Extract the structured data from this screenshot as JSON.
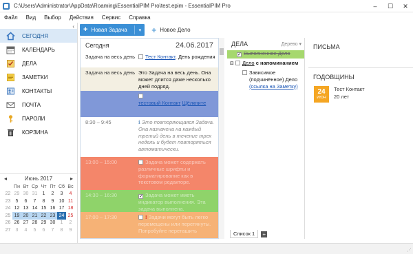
{
  "window": {
    "title": "C:\\Users\\Administrator\\AppData\\Roaming\\EssentialPIM Pro\\test.epim - EssentialPIM Pro",
    "minimize": "–",
    "maximize": "☐",
    "close": "✕"
  },
  "menu": [
    "Файл",
    "Вид",
    "Выбор",
    "Действия",
    "Сервис",
    "Справка"
  ],
  "toolbar": {
    "new_task": "Новая Задача",
    "new_item": "Новое Дело"
  },
  "sidebar": {
    "collapse": "‹",
    "items": [
      {
        "label": "СЕГОДНЯ",
        "icon": "house-icon",
        "color": "#3a78c2"
      },
      {
        "label": "КАЛЕНДАРЬ",
        "icon": "calendar-icon",
        "color": "#6d6d6d"
      },
      {
        "label": "ДЕЛА",
        "icon": "tasks-icon",
        "color": "#d8a32a"
      },
      {
        "label": "ЗАМЕТКИ",
        "icon": "notes-icon",
        "color": "#f0c232"
      },
      {
        "label": "КОНТАКТЫ",
        "icon": "contacts-icon",
        "color": "#4a7fc0"
      },
      {
        "label": "ПОЧТА",
        "icon": "mail-icon",
        "color": "#6a6a6a"
      },
      {
        "label": "ПАРОЛИ",
        "icon": "key-icon",
        "color": "#e0a020"
      },
      {
        "label": "КОРЗИНА",
        "icon": "trash-icon",
        "color": "#3a3a3a"
      }
    ]
  },
  "calendar": {
    "prev": "◂",
    "next": "▸",
    "month_title": "Июнь 2017",
    "weekdays": [
      "Пн",
      "Вт",
      "Ср",
      "Чт",
      "Пт",
      "Сб",
      "Вс"
    ],
    "weeks": [
      {
        "wk": "22",
        "days": [
          "29",
          "30",
          "31",
          "1",
          "2",
          "3",
          "4"
        ]
      },
      {
        "wk": "23",
        "days": [
          "5",
          "6",
          "7",
          "8",
          "9",
          "10",
          "11"
        ]
      },
      {
        "wk": "24",
        "days": [
          "12",
          "13",
          "14",
          "15",
          "16",
          "17",
          "18"
        ]
      },
      {
        "wk": "25",
        "days": [
          "19",
          "20",
          "21",
          "22",
          "23",
          "24",
          "25"
        ]
      },
      {
        "wk": "26",
        "days": [
          "26",
          "27",
          "28",
          "29",
          "30",
          "1",
          "2"
        ]
      },
      {
        "wk": "27",
        "days": [
          "3",
          "4",
          "5",
          "6",
          "7",
          "8",
          "9"
        ]
      }
    ]
  },
  "today_panel": {
    "title": "Сегодня",
    "date": "24.06.2017",
    "rows": [
      {
        "time": "Задача на весь день",
        "text_link": "Тест Контакт",
        "text": ". День рождения",
        "bg": "#ffffff"
      },
      {
        "time": "Задача на весь день",
        "text": "Это Задача на весь день. Она может длится даже несколько дней подряд.",
        "bg": "#f3efe2"
      },
      {
        "time": "",
        "text_link": "тестовый Контакт",
        "text2": "Щёлкните",
        "bg": "#8098d8"
      },
      {
        "time": "8:30 – 9:45",
        "text": "Это повторяющаяся Задача. Она назначена на каждый третий день в течение трех недель и будет повторяться автоматически.",
        "bg": "#ffffff"
      },
      {
        "time": "13:00 – 15:00",
        "text": "Задача может содержать различные шрифты и форматирование как в текстовом редакторе.",
        "bg": "#f4866a"
      },
      {
        "time": "14:30 – 16:30",
        "text": "Задача может иметь индикатор выполнения. Эта задача выполнена.",
        "bg": "#8fd36a"
      },
      {
        "time": "17:00 – 17:30",
        "text": "Задачи могут быть легко перемещены или перетянуты. Попробуйте переташить",
        "bg": "#f6b276"
      }
    ]
  },
  "tasks_panel": {
    "title": "ДЕЛА",
    "view": "Дерево ▾",
    "items": [
      {
        "text": "Выполненное Дело",
        "done": true
      },
      {
        "text": "Дело",
        "suffix": " с напоминанием"
      },
      {
        "text": "Зависимое (подчинённое) Дело",
        "link": "(ссылка на Заметку)"
      }
    ],
    "tab_label": "Список 1",
    "add_tab": "+"
  },
  "letters": {
    "title": "ПИСЬМА"
  },
  "anniversaries": {
    "title": "ГОДОВЩИНЫ",
    "day": "24",
    "month": "ИЮН",
    "name": "Тест Контакт",
    "years": "20 лет"
  },
  "colors": {
    "accent": "#3a8fd6",
    "active_nav": "#dbe9f7",
    "today_cell": "#2a6fb0",
    "anniv_badge": "#f5a623"
  }
}
